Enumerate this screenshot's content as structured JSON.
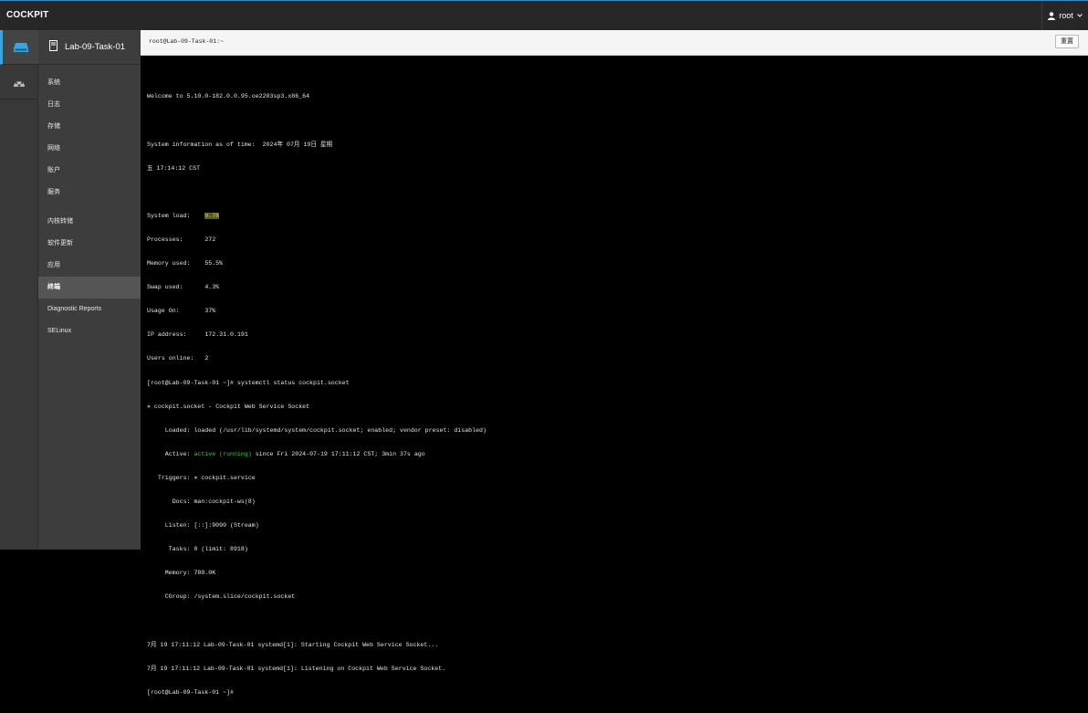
{
  "topbar": {
    "brand": "COCKPIT",
    "user": "root",
    "user_icon": "user-icon",
    "chevron_icon": "chevron-down-icon"
  },
  "iconbar": [
    {
      "name": "host-icon",
      "active": true
    },
    {
      "name": "dashboard-icon",
      "active": false
    }
  ],
  "host": {
    "name": "Lab-09-Task-01",
    "icon": "server-icon"
  },
  "nav": [
    {
      "label": "系统"
    },
    {
      "label": "日志"
    },
    {
      "label": "存储"
    },
    {
      "label": "网络"
    },
    {
      "label": "账户"
    },
    {
      "label": "服务"
    },
    {
      "label": "内核转储"
    },
    {
      "label": "软件更新"
    },
    {
      "label": "应用"
    },
    {
      "label": "终端",
      "active": true
    },
    {
      "label": "Diagnostic Reports"
    },
    {
      "label": "SELinux"
    }
  ],
  "terminal": {
    "title": "root@Lab-09-Task-01:~",
    "reset_label": "重置",
    "welcome": "Welcome to 5.10.0-182.0.0.95.oe2203sp3.x86_64",
    "sysinfo_line1": "System information as of time:  2024年 07月 19日 星期",
    "sysinfo_line2": "五 17:14:12 CST",
    "stats": [
      {
        "label": "System load:",
        "value": "0.78",
        "highlight": true
      },
      {
        "label": "Processes:",
        "value": "272"
      },
      {
        "label": "Memory used:",
        "value": "55.5%"
      },
      {
        "label": "Swap used:",
        "value": "4.3%"
      },
      {
        "label": "Usage On:",
        "value": "37%"
      },
      {
        "label": "IP address:",
        "value": "172.31.0.191"
      },
      {
        "label": "Users online:",
        "value": "2"
      }
    ],
    "cmd_prompt": "[root@Lab-09-Task-01 ~]# systemctl status cockpit.socket",
    "unit_bullet": "●",
    "unit_line": " cockpit.socket - Cockpit Web Service Socket",
    "loaded_line": "     Loaded: loaded (/usr/lib/systemd/system/cockpit.socket; enabled; vendor preset: disabled)",
    "active_prefix": "     Active: ",
    "active_state": "active (running)",
    "active_suffix": " since Fri 2024-07-19 17:11:12 CST; 3min 37s ago",
    "triggers_prefix": "   Triggers: ",
    "triggers_bullet": "●",
    "triggers_value": " cockpit.service",
    "docs_line": "       Docs: man:cockpit-ws(8)",
    "listen_line": "     Listen: [::]:9090 (Stream)",
    "tasks_line": "      Tasks: 0 (limit: 8918)",
    "memory_line": "     Memory: 780.0K",
    "cgroup_line": "     CGroup: /system.slice/cockpit.socket",
    "log1": "7月 19 17:11:12 Lab-09-Task-01 systemd[1]: Starting Cockpit Web Service Socket...",
    "log2": "7月 19 17:11:12 Lab-09-Task-01 systemd[1]: Listening on Cockpit Web Service Socket.",
    "final_prompt": "[root@Lab-09-Task-01 ~]#"
  },
  "colors": {
    "accent": "#39a5dc",
    "topbar": "#272727",
    "sidebar": "#3d3d3d",
    "terminal_bg": "#000000",
    "status_green": "#3fd23f"
  }
}
